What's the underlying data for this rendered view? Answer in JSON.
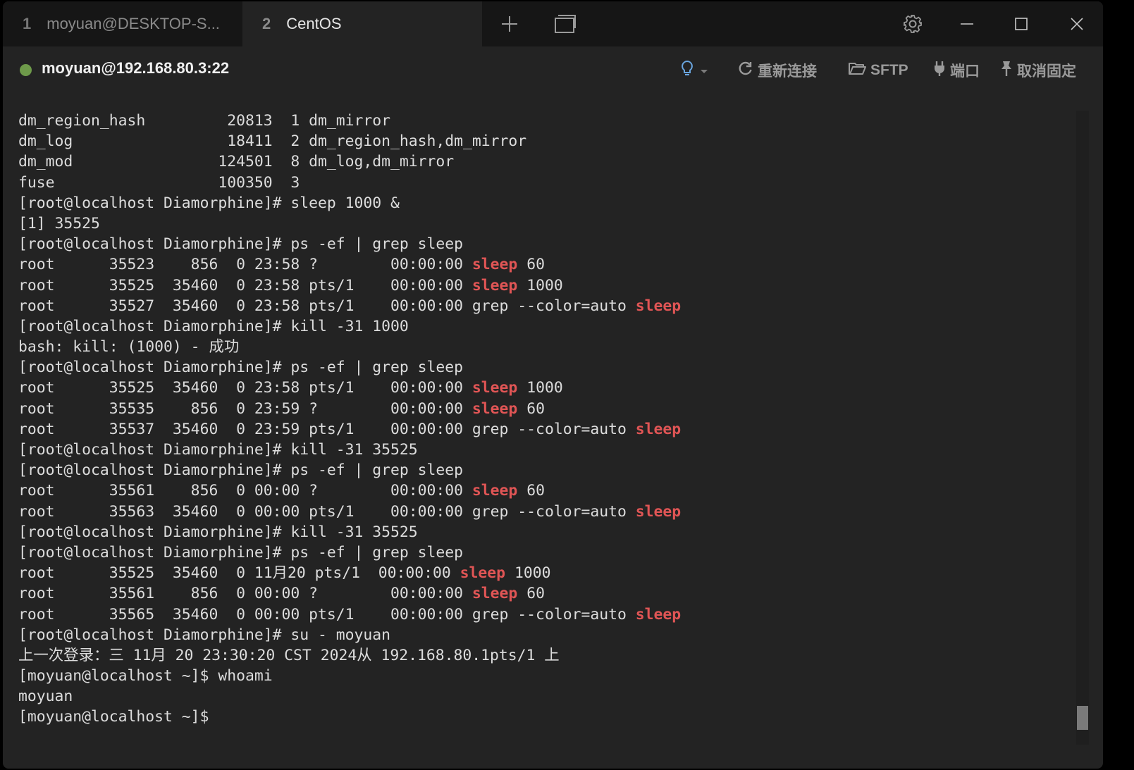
{
  "tabs": [
    {
      "num": "1",
      "label": "moyuan@DESKTOP-S..."
    },
    {
      "num": "2",
      "label": "CentOS"
    }
  ],
  "toolbar_icons": {
    "new_tab": "plus-icon",
    "split": "window-icon",
    "settings": "gear-icon",
    "minimize": "minimize-icon",
    "maximize": "maximize-icon",
    "close": "close-icon"
  },
  "session": {
    "title": "moyuan@192.168.80.3:22",
    "status_color": "#6e9a4a",
    "actions": {
      "tips_icon": "lightbulb-icon",
      "reconnect": "重新连接",
      "sftp": "SFTP",
      "port": "端口",
      "unpin": "取消固定"
    }
  },
  "colors": {
    "highlight": "#e05555",
    "text": "#dcdcdc",
    "background": "#232323"
  },
  "terminal": {
    "lines": [
      [
        {
          "t": "dm_region_hash         20813  1 dm_mirror"
        }
      ],
      [
        {
          "t": "dm_log                 18411  2 dm_region_hash,dm_mirror"
        }
      ],
      [
        {
          "t": "dm_mod                124501  8 dm_log,dm_mirror"
        }
      ],
      [
        {
          "t": "fuse                  100350  3"
        }
      ],
      [
        {
          "t": "[root@localhost Diamorphine]# sleep 1000 &"
        }
      ],
      [
        {
          "t": "[1] 35525"
        }
      ],
      [
        {
          "t": "[root@localhost Diamorphine]# ps -ef | grep sleep"
        }
      ],
      [
        {
          "t": "root      35523    856  0 23:58 ?        00:00:00 "
        },
        {
          "t": "sleep",
          "hl": true
        },
        {
          "t": " 60"
        }
      ],
      [
        {
          "t": "root      35525  35460  0 23:58 pts/1    00:00:00 "
        },
        {
          "t": "sleep",
          "hl": true
        },
        {
          "t": " 1000"
        }
      ],
      [
        {
          "t": "root      35527  35460  0 23:58 pts/1    00:00:00 grep --color=auto "
        },
        {
          "t": "sleep",
          "hl": true
        }
      ],
      [
        {
          "t": "[root@localhost Diamorphine]# kill -31 1000"
        }
      ],
      [
        {
          "t": "bash: kill: (1000) - 成功"
        }
      ],
      [
        {
          "t": "[root@localhost Diamorphine]# ps -ef | grep sleep"
        }
      ],
      [
        {
          "t": "root      35525  35460  0 23:58 pts/1    00:00:00 "
        },
        {
          "t": "sleep",
          "hl": true
        },
        {
          "t": " 1000"
        }
      ],
      [
        {
          "t": "root      35535    856  0 23:59 ?        00:00:00 "
        },
        {
          "t": "sleep",
          "hl": true
        },
        {
          "t": " 60"
        }
      ],
      [
        {
          "t": "root      35537  35460  0 23:59 pts/1    00:00:00 grep --color=auto "
        },
        {
          "t": "sleep",
          "hl": true
        }
      ],
      [
        {
          "t": "[root@localhost Diamorphine]# kill -31 35525"
        }
      ],
      [
        {
          "t": "[root@localhost Diamorphine]# ps -ef | grep sleep"
        }
      ],
      [
        {
          "t": "root      35561    856  0 00:00 ?        00:00:00 "
        },
        {
          "t": "sleep",
          "hl": true
        },
        {
          "t": " 60"
        }
      ],
      [
        {
          "t": "root      35563  35460  0 00:00 pts/1    00:00:00 grep --color=auto "
        },
        {
          "t": "sleep",
          "hl": true
        }
      ],
      [
        {
          "t": "[root@localhost Diamorphine]# kill -31 35525"
        }
      ],
      [
        {
          "t": "[root@localhost Diamorphine]# ps -ef | grep sleep"
        }
      ],
      [
        {
          "t": "root      35525  35460  0 11月20 pts/1  00:00:00 "
        },
        {
          "t": "sleep",
          "hl": true
        },
        {
          "t": " 1000"
        }
      ],
      [
        {
          "t": "root      35561    856  0 00:00 ?        00:00:00 "
        },
        {
          "t": "sleep",
          "hl": true
        },
        {
          "t": " 60"
        }
      ],
      [
        {
          "t": "root      35565  35460  0 00:00 pts/1    00:00:00 grep --color=auto "
        },
        {
          "t": "sleep",
          "hl": true
        }
      ],
      [
        {
          "t": "[root@localhost Diamorphine]# su - moyuan"
        }
      ],
      [
        {
          "t": "上一次登录：三 11月 20 23:30:20 CST 2024从 192.168.80.1pts/1 上"
        }
      ],
      [
        {
          "t": "[moyuan@localhost ~]$ whoami"
        }
      ],
      [
        {
          "t": "moyuan"
        }
      ],
      [
        {
          "t": "[moyuan@localhost ~]$ "
        }
      ]
    ]
  }
}
